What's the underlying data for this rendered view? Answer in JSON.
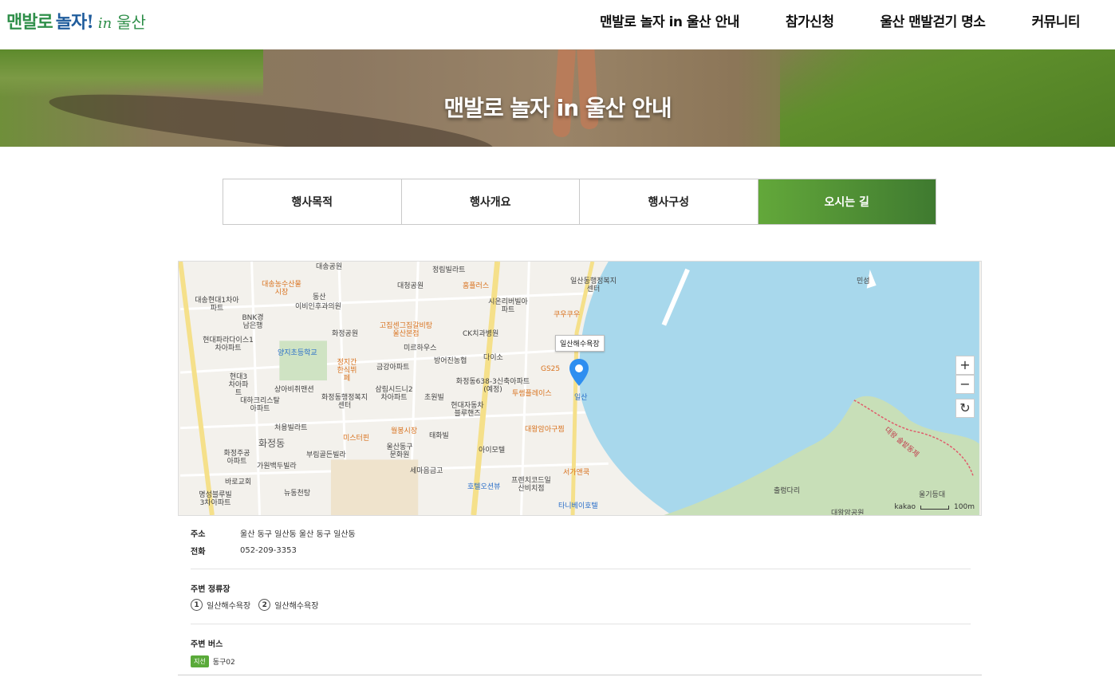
{
  "header": {
    "logo": {
      "part1": "맨발로",
      "part2": "놀자!",
      "part3": "in",
      "part4": "울산"
    },
    "nav": [
      {
        "label": "맨발로 놀자 in 울산 안내"
      },
      {
        "label": "참가신청"
      },
      {
        "label": "울산 맨발걷기 명소"
      },
      {
        "label": "커뮤니티"
      }
    ]
  },
  "hero": {
    "title": "맨발로 놀자 in 울산 안내"
  },
  "tabs": [
    {
      "label": "행사목적",
      "active": false
    },
    {
      "label": "행사개요",
      "active": false
    },
    {
      "label": "행사구성",
      "active": false
    },
    {
      "label": "오시는 길",
      "active": true
    }
  ],
  "map": {
    "marker_label": "일산해수욕장",
    "marker_sub": "일산",
    "attribution": "kakao",
    "scale_label": "100m",
    "labels": [
      "대송공원",
      "정림빌라트",
      "일산동행정복지센터",
      "민섬",
      "대송농수산물시장",
      "동산",
      "대청공원",
      "홈플러스",
      "대송현대1차아파트",
      "BNK경남은행",
      "이비인후과의원",
      "시온리버빌아파트",
      "쿠우쿠우",
      "현대파라다이스1차아파트",
      "화정공원",
      "고집센그집갈비탕울산본점",
      "양지초등학교",
      "CK치과병원",
      "미르하우스",
      "다이소",
      "현대3차아파트",
      "정지간한식뷔페",
      "금강아파트",
      "방어진농협",
      "GS25",
      "상아비취맨션",
      "화정동행정복지센터",
      "삼림시드니2차아파트",
      "화정동638-3신축아파트(예정)",
      "투썸플레이스",
      "대하크리스탈아파트",
      "초원빌",
      "현대자동차블루핸즈",
      "처용빌라트",
      "미스터핀",
      "월봉시장",
      "대왕암아구찜",
      "태화빌",
      "화정동",
      "울산동구문화원",
      "아이모텔",
      "화정주공아파트",
      "부림골든빌라",
      "가원백두빌라",
      "세마음금고",
      "서가앤쿡",
      "바로교회",
      "호텔오션뷰",
      "프렌치코드일산비치점",
      "명성블루빌3차아파트",
      "뉴동천탕",
      "타니베이호텔",
      "출렁다리",
      "울기등대",
      "대왕암공원",
      "대왕 솔밭동제"
    ]
  },
  "info": {
    "address_label": "주소",
    "address": "울산 동구 일산동 울산 동구 일산동",
    "phone_label": "전화",
    "phone": "052-209-3353",
    "parking_title": "주변 정류장",
    "parking": [
      {
        "num": "1",
        "name": "일산해수욕장"
      },
      {
        "num": "2",
        "name": "일산해수욕장"
      }
    ],
    "bus_title": "주변 버스",
    "bus_badge": "지선",
    "bus_route": "동구02"
  }
}
